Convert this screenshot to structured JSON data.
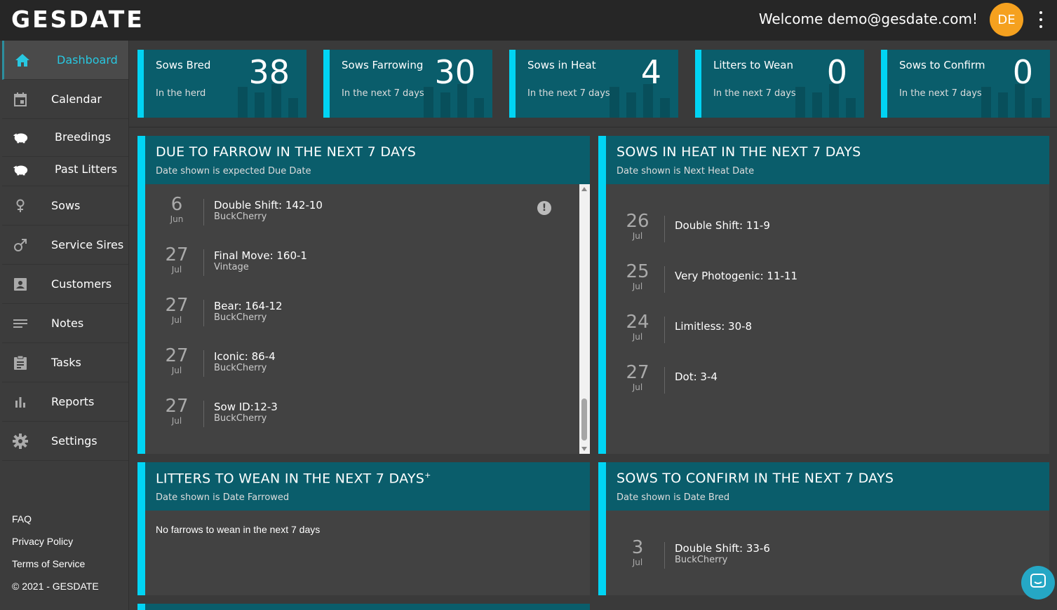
{
  "header": {
    "logo": "GESDATE",
    "welcome": "Welcome demo@gesdate.com!",
    "avatar_initials": "DE",
    "avatar_color": "#f5a11f"
  },
  "sidebar": {
    "items": [
      {
        "label": "Dashboard",
        "icon": "home-icon",
        "active": true
      },
      {
        "label": "Calendar",
        "icon": "calendar-icon"
      },
      {
        "label": "Breedings",
        "icon": "pig-icon"
      },
      {
        "label": "Past Litters",
        "icon": "pig-icon"
      },
      {
        "label": "Sows",
        "icon": "female-icon"
      },
      {
        "label": "Service Sires",
        "icon": "male-icon"
      },
      {
        "label": "Customers",
        "icon": "contact-icon"
      },
      {
        "label": "Notes",
        "icon": "notes-icon"
      },
      {
        "label": "Tasks",
        "icon": "clipboard-icon"
      },
      {
        "label": "Reports",
        "icon": "bar-chart-icon"
      },
      {
        "label": "Settings",
        "icon": "gear-icon"
      }
    ],
    "footer": {
      "faq": "FAQ",
      "privacy": "Privacy Policy",
      "terms": "Terms of Service",
      "copyright": "© 2021 - GESDATE"
    }
  },
  "stats": [
    {
      "title": "Sows Bred",
      "sub": "In the herd",
      "value": "38"
    },
    {
      "title": "Sows Farrowing",
      "sub": "In the next 7 days",
      "value": "30"
    },
    {
      "title": "Sows in Heat",
      "sub": "In the next 7 days",
      "value": "4"
    },
    {
      "title": "Litters to Wean",
      "sub": "In the next 7 days",
      "value": "0"
    },
    {
      "title": "Sows to Confirm",
      "sub": "In the next 7 days",
      "value": "0"
    }
  ],
  "panels": {
    "farrow": {
      "title": "DUE TO FARROW IN THE NEXT 7 DAYS",
      "sub": "Date shown is expected Due Date",
      "info_icon": "!",
      "rows": [
        {
          "day": "6",
          "month": "Jun",
          "name": "Double Shift: 142-10",
          "farm": "BuckCherry"
        },
        {
          "day": "27",
          "month": "Jul",
          "name": "Final Move: 160-1",
          "farm": "Vintage"
        },
        {
          "day": "27",
          "month": "Jul",
          "name": "Bear: 164-12",
          "farm": "BuckCherry"
        },
        {
          "day": "27",
          "month": "Jul",
          "name": "Iconic: 86-4",
          "farm": "BuckCherry"
        },
        {
          "day": "27",
          "month": "Jul",
          "name": "Sow ID:12-3",
          "farm": "BuckCherry"
        }
      ]
    },
    "heat": {
      "title": "SOWS IN HEAT IN THE NEXT 7 DAYS",
      "sub": "Date shown is Next Heat Date",
      "rows": [
        {
          "day": "26",
          "month": "Jul",
          "name": "Double Shift: 11-9"
        },
        {
          "day": "25",
          "month": "Jul",
          "name": "Very Photogenic: 11-11"
        },
        {
          "day": "24",
          "month": "Jul",
          "name": "Limitless: 30-8"
        },
        {
          "day": "27",
          "month": "Jul",
          "name": "Dot: 3-4"
        }
      ]
    },
    "wean": {
      "title": "LITTERS TO WEAN IN THE NEXT 7 DAYS",
      "title_sup": "+",
      "sub": "Date shown is Date Farrowed",
      "empty": "No farrows to wean in the next 7 days"
    },
    "confirm": {
      "title": "SOWS TO CONFIRM IN THE NEXT 7 DAYS",
      "sub": "Date shown is Date Bred",
      "rows": [
        {
          "day": "3",
          "month": "Jul",
          "name": "Double Shift: 33-6",
          "farm": "BuckCherry"
        }
      ]
    }
  },
  "colors": {
    "accent": "#00d4f4",
    "panel_header": "#0a5d6b",
    "active_nav": "#28c7e0"
  }
}
